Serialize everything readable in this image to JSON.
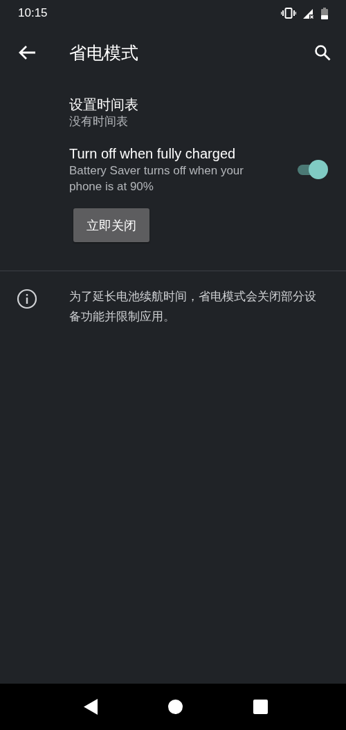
{
  "status_bar": {
    "time": "10:15"
  },
  "app_bar": {
    "title": "省电模式"
  },
  "settings": [
    {
      "kind": "text",
      "title": "设置时间表",
      "summary": "没有时间表"
    },
    {
      "kind": "switch",
      "title": "Turn off when fully charged",
      "summary": "Battery Saver turns off when your phone is at 90%",
      "on": true
    }
  ],
  "action_button": {
    "label": "立即关闭"
  },
  "info": {
    "text": "为了延长电池续航时间，省电模式会关闭部分设备功能并限制应用。"
  }
}
